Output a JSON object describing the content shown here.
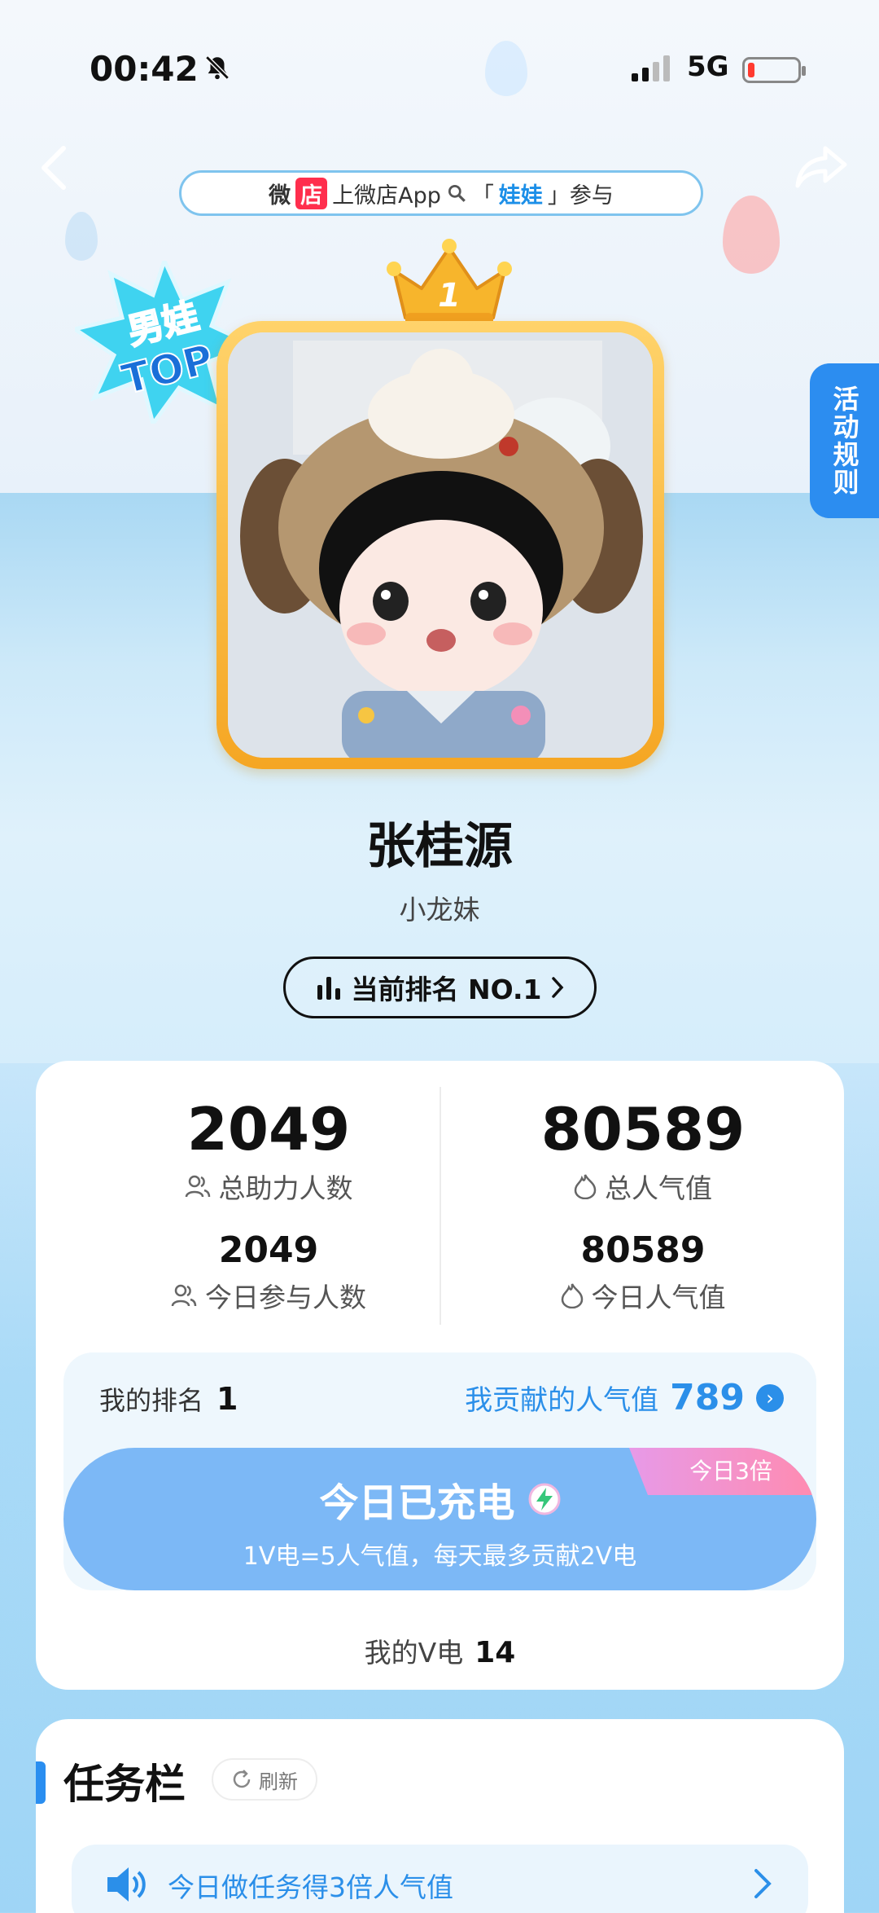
{
  "status": {
    "time": "00:42",
    "network": "5G",
    "battery_percent": 10
  },
  "banner": {
    "logo_part1": "微",
    "logo_part2": "店",
    "text": "上微店App",
    "bracket_open": "「",
    "keyword": "娃娃",
    "bracket_close": "」参与"
  },
  "badge": {
    "line1": "男娃",
    "line2": "TOP"
  },
  "rules_tab": "活动规则",
  "crown_rank": "1",
  "doll": {
    "name": "张桂源",
    "owner": "小龙妹"
  },
  "rank_pill": "当前排名 NO.1",
  "stats": {
    "total_helpers_value": "2049",
    "total_helpers_label": "总助力人数",
    "total_popularity_value": "80589",
    "total_popularity_label": "总人气值",
    "today_participants_value": "2049",
    "today_participants_label": "今日参与人数",
    "today_popularity_value": "80589",
    "today_popularity_label": "今日人气值"
  },
  "contribution": {
    "my_rank_label": "我的排名",
    "my_rank_value": "1",
    "contributed_label": "我贡献的人气值",
    "contributed_value": "789"
  },
  "charge": {
    "title": "今日已充电",
    "subtitle": "1V电=5人气值，每天最多贡献2V电",
    "multiplier": "今日3倍"
  },
  "my_v": {
    "label": "我的V电",
    "value": "14"
  },
  "tasks": {
    "title": "任务栏",
    "refresh_label": "刷新",
    "notice": "今日做任务得3倍人气值"
  },
  "colors": {
    "accent_blue": "#2b8fe9",
    "charge_button": "#7cb8f6",
    "crown_gold": "#f5a623"
  }
}
